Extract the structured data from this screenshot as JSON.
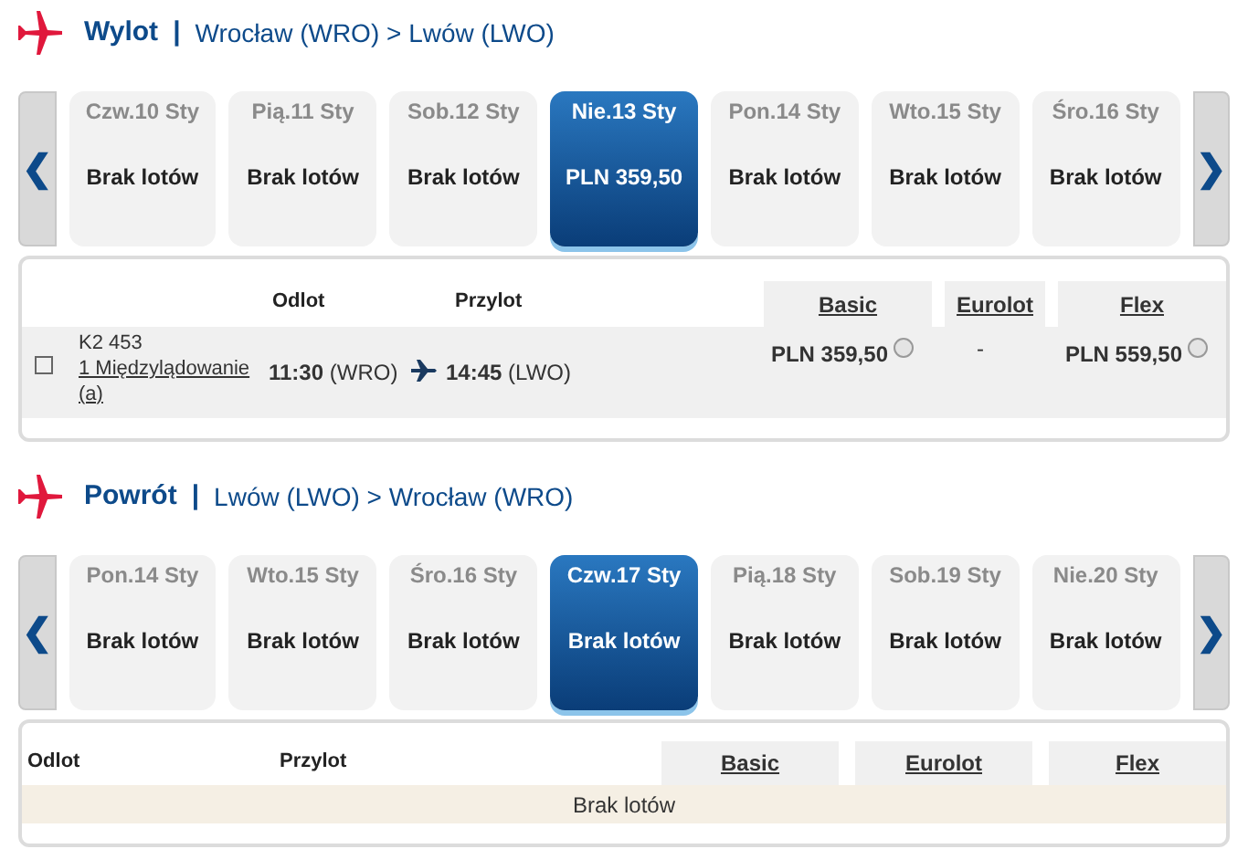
{
  "sections": [
    {
      "title": "Wylot",
      "separator": "|",
      "route": "Wrocław (WRO) > Lwów (LWO)",
      "prev": "❮",
      "next": "❯",
      "days": [
        {
          "date": "Czw.10 Sty",
          "info": "Brak lotów",
          "selected": false
        },
        {
          "date": "Pią.11 Sty",
          "info": "Brak lotów",
          "selected": false
        },
        {
          "date": "Sob.12 Sty",
          "info": "Brak lotów",
          "selected": false
        },
        {
          "date": "Nie.13 Sty",
          "info": "PLN 359,50",
          "selected": true
        },
        {
          "date": "Pon.14 Sty",
          "info": "Brak lotów",
          "selected": false
        },
        {
          "date": "Wto.15 Sty",
          "info": "Brak lotów",
          "selected": false
        },
        {
          "date": "Śro.16 Sty",
          "info": "Brak lotów",
          "selected": false
        }
      ],
      "results": {
        "kind": "flights",
        "columns": [
          "Odlot",
          "Przylot"
        ],
        "fares": [
          "Basic",
          "Eurolot",
          "Flex"
        ],
        "rows": [
          {
            "flight": "K2 453",
            "stops": "1 Międzylądowanie (a)",
            "dep_time": "11:30",
            "dep_code": "(WRO)",
            "arr_time": "14:45",
            "arr_code": "(LWO)",
            "prices": [
              {
                "kind": "price",
                "text": "PLN 359,50",
                "selected": false
              },
              {
                "kind": "none",
                "text": "-"
              },
              {
                "kind": "price",
                "text": "PLN 559,50",
                "selected": false
              }
            ]
          }
        ]
      }
    },
    {
      "title": "Powrót",
      "separator": "|",
      "route": "Lwów (LWO) > Wrocław (WRO)",
      "prev": "❮",
      "next": "❯",
      "days": [
        {
          "date": "Pon.14 Sty",
          "info": "Brak lotów",
          "selected": false
        },
        {
          "date": "Wto.15 Sty",
          "info": "Brak lotów",
          "selected": false
        },
        {
          "date": "Śro.16 Sty",
          "info": "Brak lotów",
          "selected": false
        },
        {
          "date": "Czw.17 Sty",
          "info": "Brak lotów",
          "selected": true
        },
        {
          "date": "Pią.18 Sty",
          "info": "Brak lotów",
          "selected": false
        },
        {
          "date": "Sob.19 Sty",
          "info": "Brak lotów",
          "selected": false
        },
        {
          "date": "Nie.20 Sty",
          "info": "Brak lotów",
          "selected": false
        }
      ],
      "results": {
        "kind": "empty",
        "columns": [
          "Odlot",
          "Przylot"
        ],
        "fares": [
          "Basic",
          "Eurolot",
          "Flex"
        ],
        "message": "Brak lotów"
      }
    }
  ]
}
